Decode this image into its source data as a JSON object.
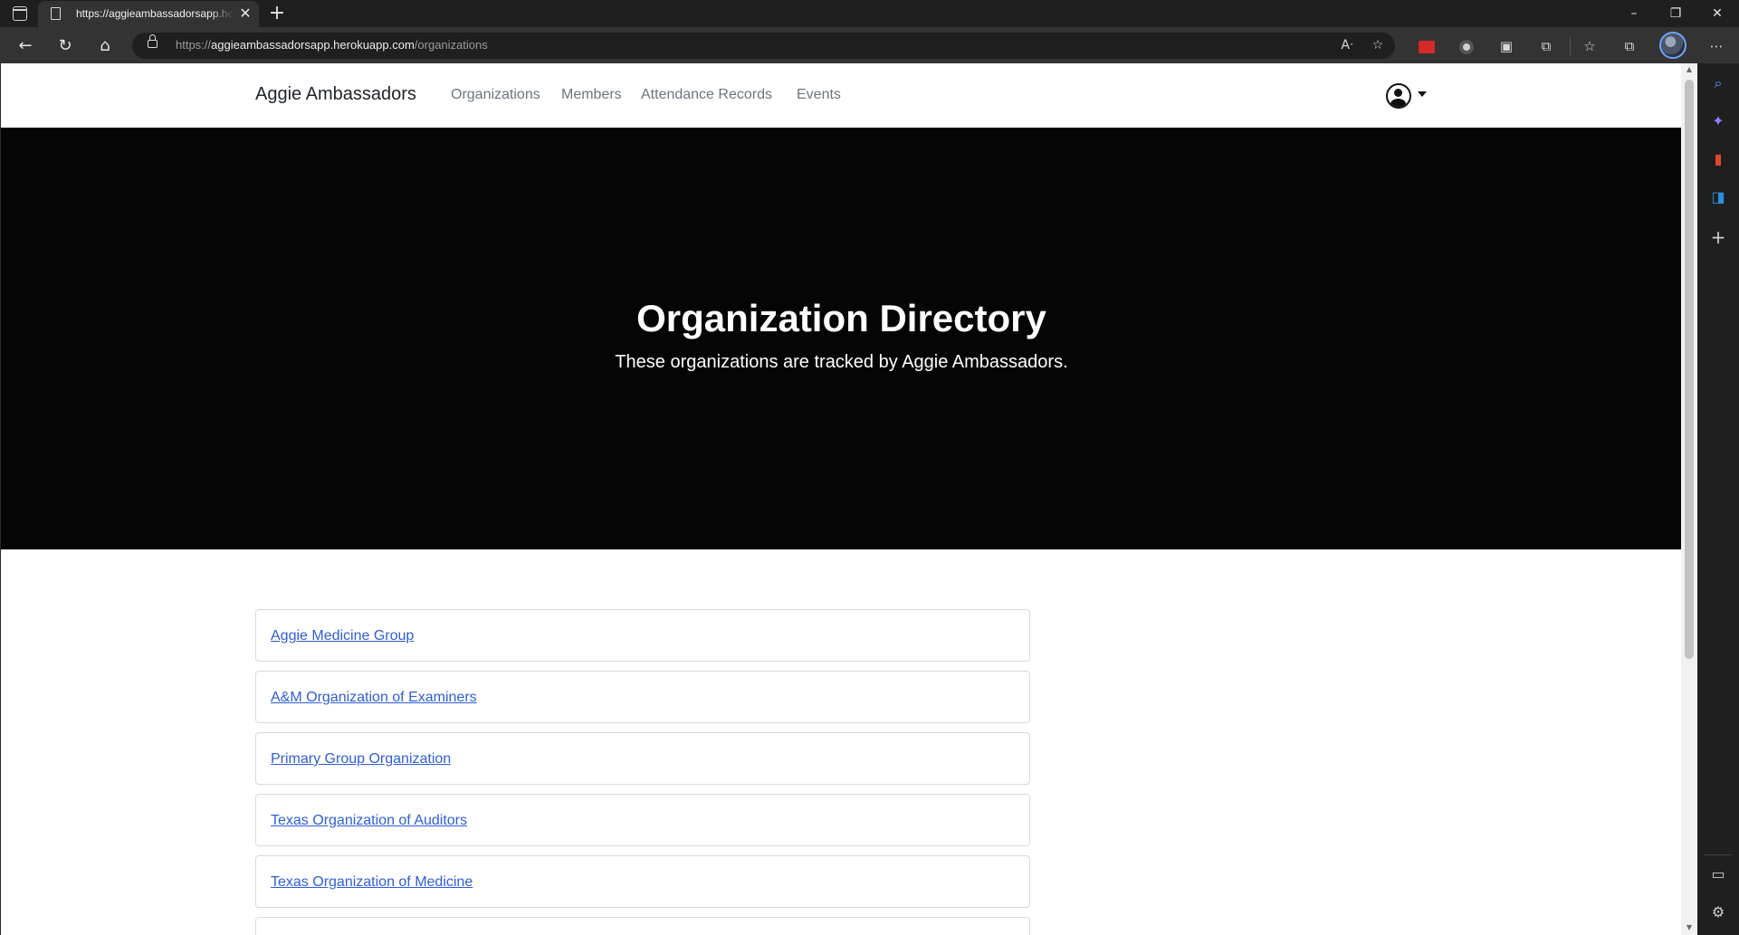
{
  "browser": {
    "tab": {
      "title": "https://aggieambassadorsapp.herokuapp.com/organizations",
      "close_glyph": "✕"
    },
    "new_tab_glyph": "+",
    "window": {
      "minimize": "–",
      "restore": "❐",
      "close": "✕"
    },
    "nav": {
      "back": "←",
      "refresh": "↻",
      "home": "⌂"
    },
    "address": {
      "protocol": "https://",
      "host": "aggieambassadorsapp.herokuapp.com",
      "path": "/organizations"
    },
    "address_icons": {
      "read_aloud": "Aᐧ",
      "add_favorite": "☆"
    },
    "toolbar_icons": {
      "extensions": "⧉",
      "favorites": "☆",
      "collections": "⧉",
      "more": "⋯"
    },
    "sidebar_icons": {
      "search": "⌕",
      "copilot": "✦",
      "office": "▮",
      "outlook": "◨",
      "add": "+",
      "panel": "▭",
      "settings": "⚙"
    },
    "colors": {
      "chrome_dark": "#1f1f1f",
      "chrome_bar": "#333333",
      "accent_blue": "#6fa3ff"
    }
  },
  "site": {
    "brand": "Aggie Ambassadors",
    "nav_links": [
      "Organizations",
      "Members",
      "Attendance Records",
      "Events"
    ]
  },
  "hero": {
    "title": "Organization Directory",
    "subtitle": "These organizations are tracked by Aggie Ambassadors."
  },
  "organizations": [
    "Aggie Medicine Group",
    "A&M Organization of Examiners",
    "Primary Group Organization",
    "Texas Organization of Auditors",
    "Texas Organization of Medicine",
    ""
  ],
  "colors": {
    "hero_bg": "#050505",
    "link": "#2f5ed4",
    "nav_text": "#6c757d"
  }
}
